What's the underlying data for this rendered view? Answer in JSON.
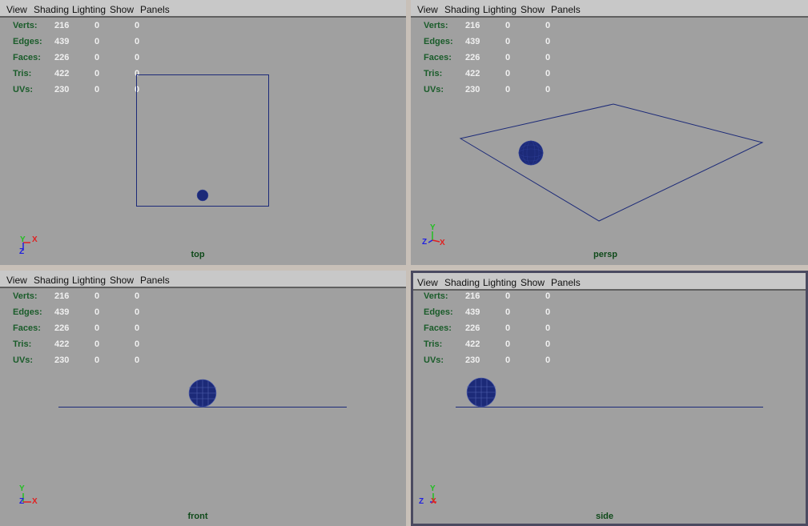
{
  "menu": [
    "View",
    "Shading",
    "Lighting",
    "Show",
    "Panels"
  ],
  "hud_labels": [
    "Verts:",
    "Edges:",
    "Faces:",
    "Tris:",
    "UVs:"
  ],
  "hud_values": [
    [
      "216",
      "0",
      "0"
    ],
    [
      "439",
      "0",
      "0"
    ],
    [
      "226",
      "0",
      "0"
    ],
    [
      "422",
      "0",
      "0"
    ],
    [
      "230",
      "0",
      "0"
    ]
  ],
  "viewports": [
    {
      "camera": "top",
      "axes": [
        "Y",
        "X",
        "Z"
      ]
    },
    {
      "camera": "persp",
      "axes": [
        "Y",
        "Z",
        "X"
      ]
    },
    {
      "camera": "front",
      "axes": [
        "Y",
        "Z",
        "X"
      ]
    },
    {
      "camera": "side",
      "axes": [
        "Y",
        "Z",
        "X"
      ]
    }
  ],
  "colors": {
    "viewport_bg": "#a0a0a0",
    "wireframe": "#1c2a78",
    "axis_x": "#e02020",
    "axis_y": "#20c020",
    "axis_z": "#2020e0"
  }
}
